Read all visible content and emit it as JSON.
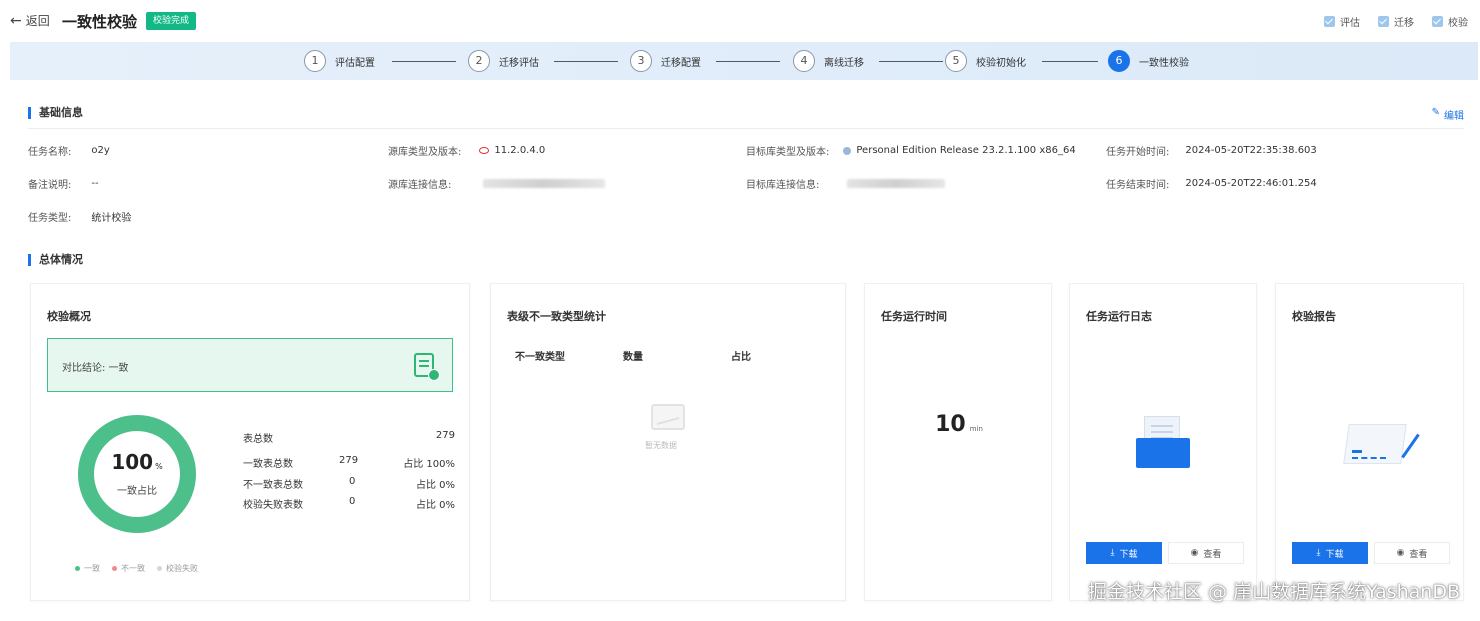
{
  "header": {
    "back_label": "返回",
    "title": "一致性校验",
    "status_badge": "校验完成",
    "modes": [
      "评估",
      "迁移",
      "校验"
    ]
  },
  "stepper": {
    "steps": [
      {
        "num": "1",
        "label": "评估配置"
      },
      {
        "num": "2",
        "label": "迁移评估"
      },
      {
        "num": "3",
        "label": "迁移配置"
      },
      {
        "num": "4",
        "label": "离线迁移"
      },
      {
        "num": "5",
        "label": "校验初始化"
      },
      {
        "num": "6",
        "label": "一致性校验"
      }
    ],
    "active_step": 6
  },
  "basic_info": {
    "section_title": "基础信息",
    "edit_label": "编辑",
    "task_name_label": "任务名称:",
    "task_name": "o2y",
    "remark_label": "备注说明:",
    "remark": "--",
    "task_type_label": "任务类型:",
    "task_type": "统计校验",
    "source_type_label": "源库类型及版本:",
    "source_type": "11.2.0.4.0",
    "source_conn_label": "源库连接信息:",
    "target_type_label": "目标库类型及版本:",
    "target_type": "Personal Edition Release 23.2.1.100 x86_64",
    "target_conn_label": "目标库连接信息:",
    "start_time_label": "任务开始时间:",
    "start_time": "2024-05-20T22:35:38.603",
    "end_time_label": "任务结束时间:",
    "end_time": "2024-05-20T22:46:01.254"
  },
  "overview": {
    "section_title": "总体情况",
    "check_overview": {
      "title": "校验概况",
      "result_text": "对比结论: 一致",
      "donut_percent": "100",
      "donut_unit": "%",
      "donut_label": "一致占比",
      "consistent_ratio": 1.0,
      "stats": [
        {
          "name": "表总数",
          "count": "",
          "ratio": "279"
        },
        {
          "name": "一致表总数",
          "count": "279",
          "ratio": "占比 100%"
        },
        {
          "name": "不一致表总数",
          "count": "0",
          "ratio": "占比 0%"
        },
        {
          "name": "校验失败表数",
          "count": "0",
          "ratio": "占比 0%"
        }
      ],
      "legend": [
        {
          "label": "一致",
          "color": "#4cbf8a"
        },
        {
          "label": "不一致",
          "color": "#f08a8a"
        },
        {
          "label": "校验失败",
          "color": "#d6d6d6"
        }
      ]
    },
    "inconsistency_stats": {
      "title": "表级不一致类型统计",
      "columns": [
        "不一致类型",
        "数量",
        "占比"
      ],
      "empty_text": "暂无数据"
    },
    "runtime": {
      "title": "任务运行时间",
      "value": "10",
      "unit": "min"
    },
    "run_log": {
      "title": "任务运行日志",
      "download_label": "下载",
      "view_label": "查看"
    },
    "report": {
      "title": "校验报告",
      "download_label": "下载",
      "view_label": "查看"
    }
  },
  "colors": {
    "primary": "#1a73e8",
    "success": "#12b886",
    "donut": "#4cbf8a"
  },
  "watermark": "掘金技术社区 @ 崖山数据库系统YashanDB"
}
